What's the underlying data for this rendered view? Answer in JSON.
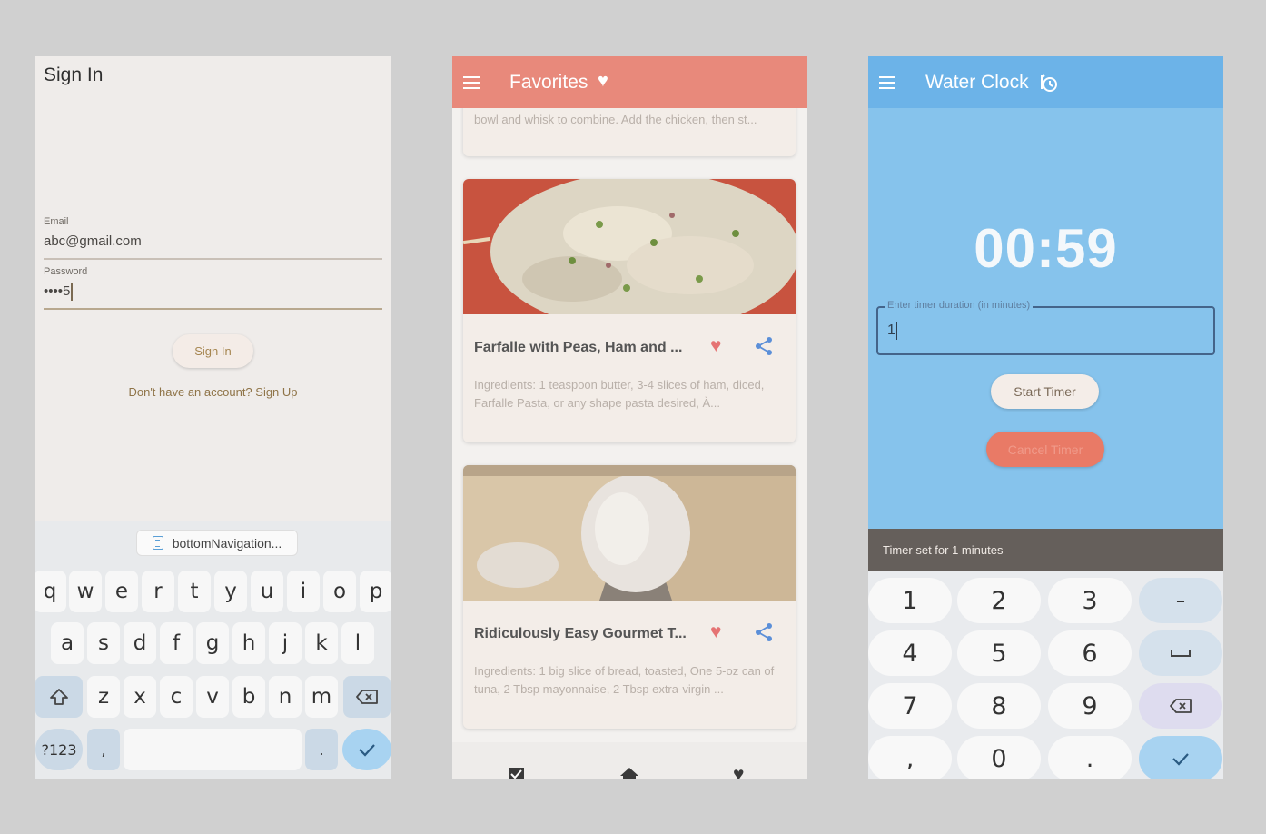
{
  "signin": {
    "title": "Sign In",
    "email_label": "Email",
    "email_value": "abc@gmail.com",
    "password_label": "Password",
    "password_value": "••••5",
    "signin_button": "Sign In",
    "signup_link": "Don't have an account? Sign Up",
    "keyboard": {
      "suggestion": "bottomNavigation...",
      "row1": [
        "q",
        "w",
        "e",
        "r",
        "t",
        "y",
        "u",
        "i",
        "o",
        "p"
      ],
      "row2": [
        "a",
        "s",
        "d",
        "f",
        "g",
        "h",
        "j",
        "k",
        "l"
      ],
      "row3": [
        "z",
        "x",
        "c",
        "v",
        "b",
        "n",
        "m"
      ],
      "symbols_key": "?123",
      "comma_key": ",",
      "period_key": "."
    }
  },
  "favorites": {
    "title": "Favorites",
    "top_snippet": "bowl and whisk to combine. Add the chicken, then st...",
    "cards": [
      {
        "title": "Farfalle with Peas, Ham and ...",
        "description": "Ingredients: 1 teaspoon butter, 3-4 slices of ham, diced, Farfalle Pasta, or any shape pasta desired, À..."
      },
      {
        "title": "Ridiculously Easy Gourmet T...",
        "description": "Ingredients: 1 big slice of bread, toasted, One 5-oz can of tuna, 2 Tbsp mayonnaise, 2 Tbsp extra-virgin ..."
      }
    ],
    "icons": [
      "menu-icon",
      "heart-icon",
      "share-icon",
      "checkbox-icon",
      "home-icon"
    ]
  },
  "waterclock": {
    "title": "Water Clock",
    "timer_display": "00:59",
    "field_label": "Enter timer duration (in minutes)",
    "field_value": "1",
    "start_button": "Start Timer",
    "cancel_button": "Cancel Timer",
    "snackbar": "Timer set for 1 minutes",
    "numpad": {
      "digits": [
        "1",
        "2",
        "3",
        "4",
        "5",
        "6",
        "7",
        "8",
        "9"
      ],
      "comma": ",",
      "zero": "0",
      "period": ".",
      "minus": "–"
    }
  },
  "colors": {
    "background": "#d0d0d0",
    "favorites_bar": "#e8897b",
    "waterclock_bar": "#6cb3e8",
    "waterclock_bg": "#86c3ec",
    "heart": "#e57373"
  }
}
